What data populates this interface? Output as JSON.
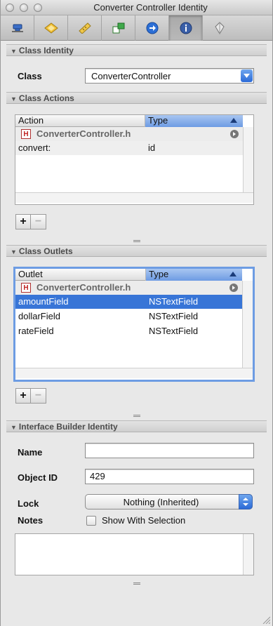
{
  "window": {
    "title": "Converter Controller Identity"
  },
  "toolbar": {
    "tabs": [
      {
        "icon": "attributes-icon"
      },
      {
        "icon": "effects-icon"
      },
      {
        "icon": "size-ruler-icon"
      },
      {
        "icon": "connections-icon"
      },
      {
        "icon": "bindings-arrow-icon"
      },
      {
        "icon": "identity-info-icon",
        "selected": true
      },
      {
        "icon": "applescript-icon"
      }
    ]
  },
  "class_identity": {
    "header": "Class Identity",
    "class_label": "Class",
    "class_value": "ConverterController"
  },
  "class_actions": {
    "header": "Class Actions",
    "columns": [
      "Action",
      "Type"
    ],
    "group": "ConverterController.h",
    "rows": [
      {
        "name": "convert:",
        "type": "id"
      }
    ],
    "add_label": "+",
    "remove_label": "−"
  },
  "class_outlets": {
    "header": "Class Outlets",
    "columns": [
      "Outlet",
      "Type"
    ],
    "group": "ConverterController.h",
    "rows": [
      {
        "name": "amountField",
        "type": "NSTextField"
      },
      {
        "name": "dollarField",
        "type": "NSTextField"
      },
      {
        "name": "rateField",
        "type": "NSTextField"
      }
    ],
    "add_label": "+",
    "remove_label": "−"
  },
  "ib_identity": {
    "header": "Interface Builder Identity",
    "name_label": "Name",
    "name_value": "",
    "object_id_label": "Object ID",
    "object_id_value": "429",
    "lock_label": "Lock",
    "lock_value": "Nothing (Inherited)",
    "notes_label": "Notes",
    "show_with_selection": "Show With Selection",
    "notes_text": ""
  }
}
